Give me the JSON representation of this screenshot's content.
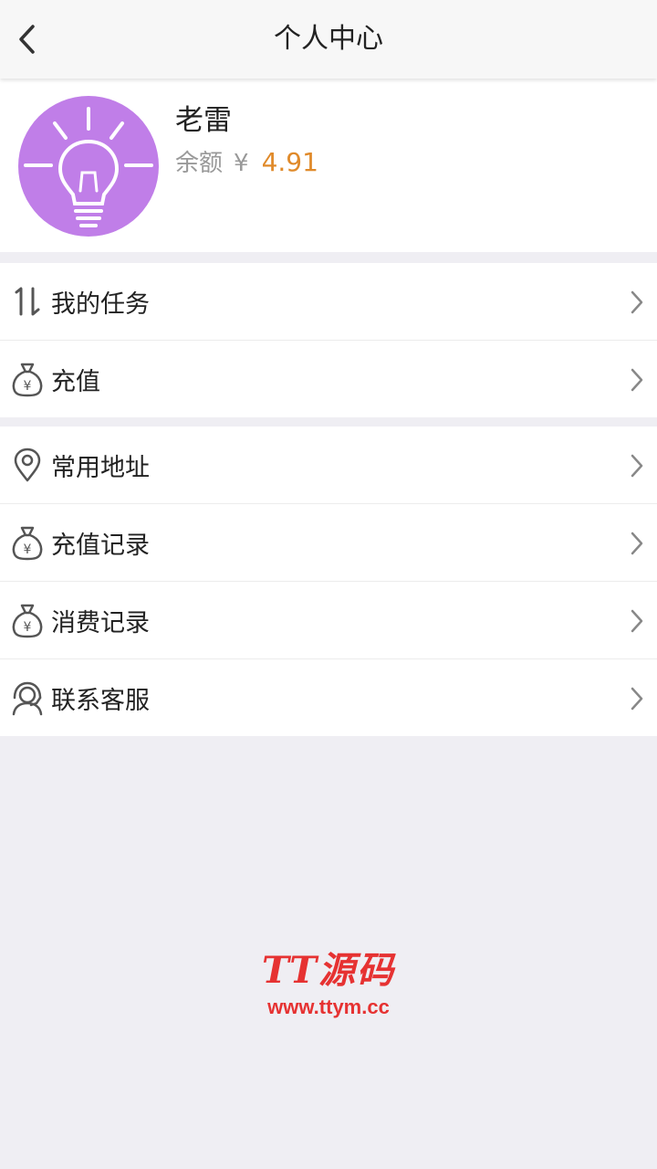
{
  "header": {
    "title": "个人中心"
  },
  "profile": {
    "name": "老雷",
    "balance_label": "余额",
    "currency": "¥",
    "balance": "4.91"
  },
  "menu_group_1": [
    {
      "label": "我的任务",
      "icon": "sort-arrows-icon"
    },
    {
      "label": "充值",
      "icon": "money-bag-icon"
    }
  ],
  "menu_group_2": [
    {
      "label": "常用地址",
      "icon": "location-pin-icon"
    },
    {
      "label": "充值记录",
      "icon": "money-bag-icon"
    },
    {
      "label": "消费记录",
      "icon": "money-bag-icon"
    },
    {
      "label": "联系客服",
      "icon": "customer-service-icon"
    }
  ],
  "watermark": {
    "title": "TT源码",
    "url": "www.ttym.cc"
  },
  "colors": {
    "accent": "#e08a2a",
    "avatar": "#c07ee8",
    "watermark": "#e63232"
  }
}
